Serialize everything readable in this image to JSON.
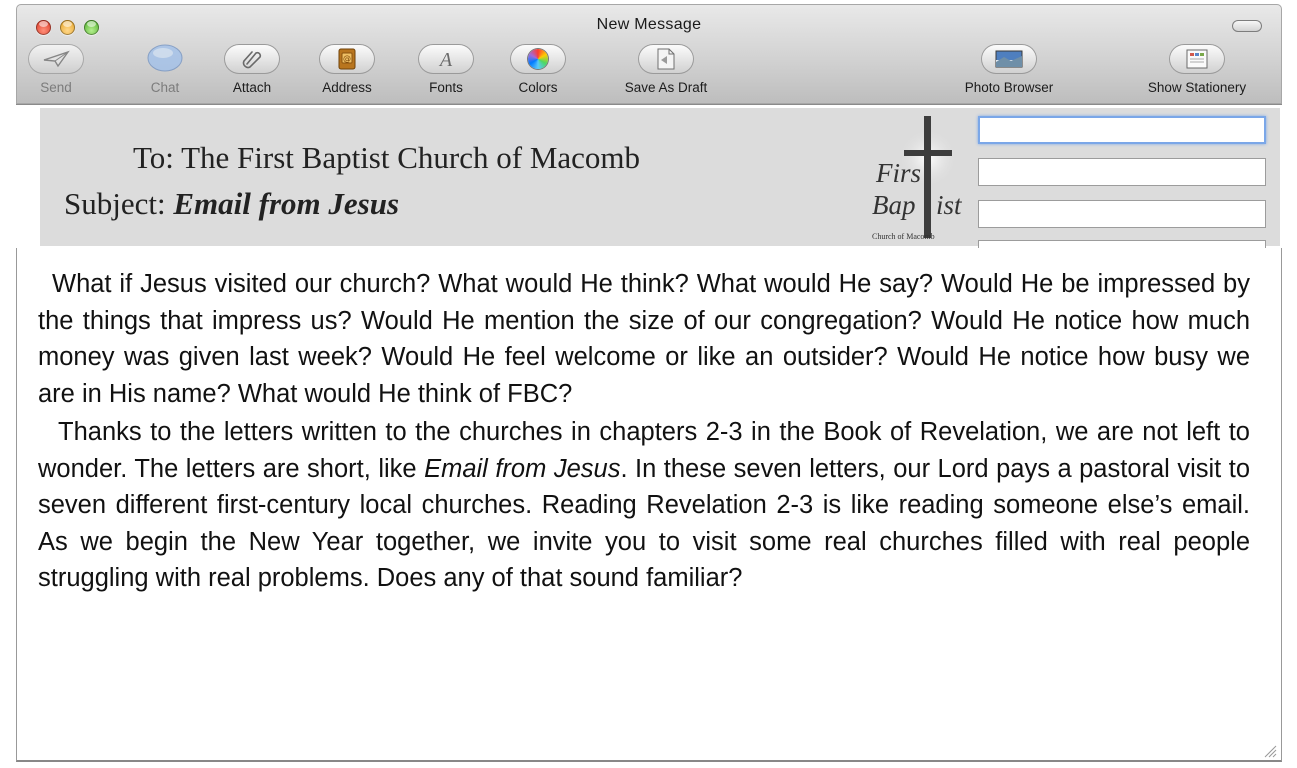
{
  "window": {
    "title": "New Message"
  },
  "toolbar": {
    "send_label": "Send",
    "chat_label": "Chat",
    "attach_label": "Attach",
    "address_label": "Address",
    "fonts_label": "Fonts",
    "colors_label": "Colors",
    "save_draft_label": "Save As Draft",
    "photo_browser_label": "Photo Browser",
    "show_stationery_label": "Show Stationery"
  },
  "header": {
    "to_label": "To:",
    "to_value": "The First Baptist Church of Macomb",
    "subject_label": "Subject:",
    "subject_value": "Email from Jesus"
  },
  "logo": {
    "line1": "Firs",
    "line2": "Bap",
    "line3": "ist",
    "tagline": "Church of Macomb"
  },
  "message": {
    "p1": "What if Jesus visited our church?  What would He think? What would He say? Would He be impressed by the things that impress us?  Would He mention the size of our congregation? Would He notice how much money was given last week? Would He feel welcome or like an outsider? Would He notice how busy we are in His name? What would He think of FBC?",
    "p2_a": "Thanks to the letters written to the churches in chapters 2-3 in the Book of Revelation, we are not left to wonder. The letters are short, like ",
    "p2_italic": "Email from Jesus",
    "p2_b": ".  In these seven letters, our Lord pays a pastoral visit to seven different first-century local churches. Reading Revelation 2-3 is like reading someone else’s email. As we begin the New Year together, we invite you to visit some real churches filled with real people struggling with real problems. Does any of that sound familiar?"
  }
}
